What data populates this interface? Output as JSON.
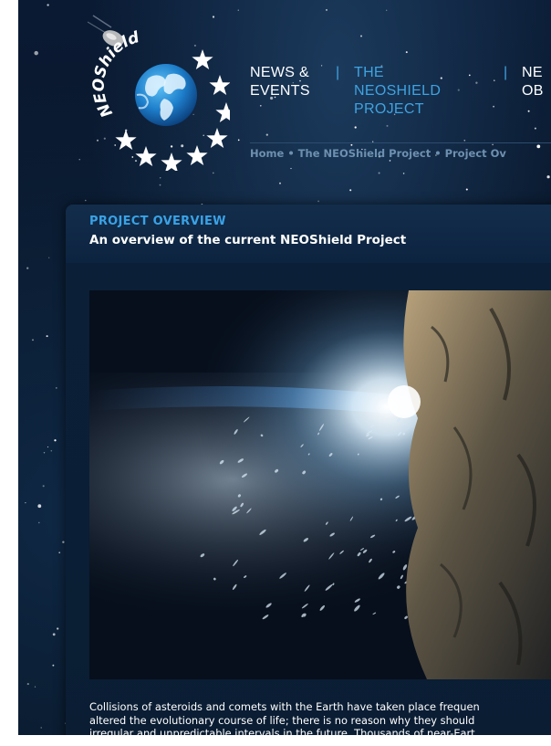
{
  "logo": {
    "text": "NEOShield"
  },
  "nav": {
    "items": [
      {
        "line1": "NEWS &",
        "line2": "EVENTS",
        "active": false
      },
      {
        "line1": "THE NEOSHIELD",
        "line2": "PROJECT",
        "active": true
      },
      {
        "line1": "NE",
        "line2": "OB",
        "active": false
      }
    ],
    "separator": "|"
  },
  "breadcrumb": {
    "items": [
      "Home",
      "The NEOShield Project",
      "Project Ov"
    ],
    "separator": "•"
  },
  "panel": {
    "title": "PROJECT OVERVIEW",
    "subtitle": "An overview of the current NEOShield Project"
  },
  "body": {
    "lines": [
      "Collisions of asteroids and comets with the Earth have taken place frequen",
      "altered the evolutionary course of life; there is no reason why they should",
      "irregular and unpredictable intervals in the future. Thousands of near-Eart"
    ]
  },
  "colors": {
    "accent": "#3fa3e0",
    "background": "#0a1a33",
    "text": "#ffffff"
  }
}
